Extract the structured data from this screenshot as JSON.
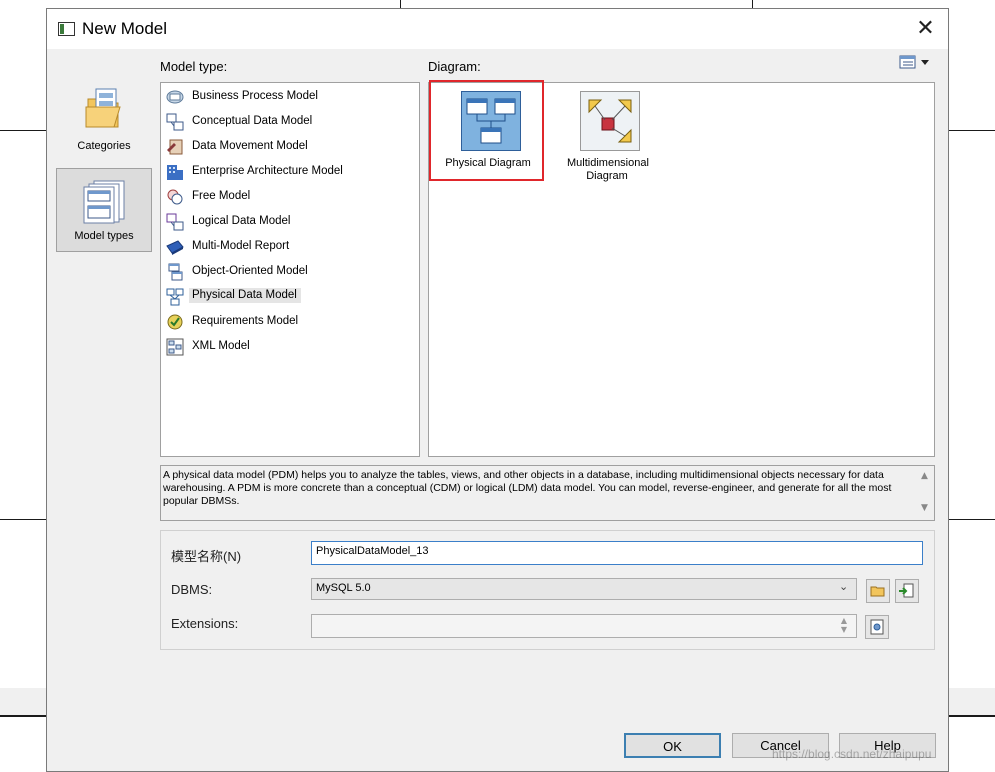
{
  "window": {
    "title": "New Model",
    "close_glyph": "✕"
  },
  "categories": {
    "items": [
      {
        "label": "Categories",
        "icon": "folder-documents-icon"
      },
      {
        "label": "Model types",
        "icon": "model-types-icon",
        "selected": true
      }
    ]
  },
  "model_type": {
    "label": "Model type:",
    "items": [
      {
        "label": "Business Process Model",
        "icon": "business-process-model-icon"
      },
      {
        "label": "Conceptual Data Model",
        "icon": "conceptual-data-model-icon"
      },
      {
        "label": "Data Movement Model",
        "icon": "data-movement-model-icon"
      },
      {
        "label": "Enterprise Architecture Model",
        "icon": "enterprise-architecture-model-icon"
      },
      {
        "label": "Free Model",
        "icon": "free-model-icon"
      },
      {
        "label": "Logical Data Model",
        "icon": "logical-data-model-icon"
      },
      {
        "label": "Multi-Model Report",
        "icon": "multi-model-report-icon"
      },
      {
        "label": "Object-Oriented Model",
        "icon": "object-oriented-model-icon"
      },
      {
        "label": "Physical Data Model",
        "icon": "physical-data-model-icon",
        "selected": true
      },
      {
        "label": "Requirements Model",
        "icon": "requirements-model-icon"
      },
      {
        "label": "XML Model",
        "icon": "xml-model-icon"
      }
    ]
  },
  "diagram": {
    "label": "Diagram:",
    "items": [
      {
        "label": "Physical Diagram",
        "icon": "physical-diagram-icon",
        "selected": true
      },
      {
        "label": "Multidimensional Diagram",
        "icon": "multidimensional-diagram-icon"
      }
    ]
  },
  "description": "A physical data model (PDM) helps you to analyze the tables, views, and other objects in a database, including multidimensional objects necessary for data warehousing. A PDM is more concrete than a conceptual (CDM) or logical (LDM) data model. You can model, reverse-engineer, and generate for all the most popular DBMSs.",
  "form": {
    "name_label": "模型名称(N)",
    "name_value": "PhysicalDataModel_13",
    "dbms_label": "DBMS:",
    "dbms_value": "MySQL 5.0",
    "extensions_label": "Extensions:",
    "extensions_value": ""
  },
  "buttons": {
    "ok": "OK",
    "cancel": "Cancel",
    "help": "Help"
  },
  "watermark": "https://blog.csdn.net/zhaipupu",
  "colors": {
    "selection_highlight": "#e0262b",
    "default_button_border": "#3c7fb1",
    "input_focus_border": "#3b7fc9"
  }
}
